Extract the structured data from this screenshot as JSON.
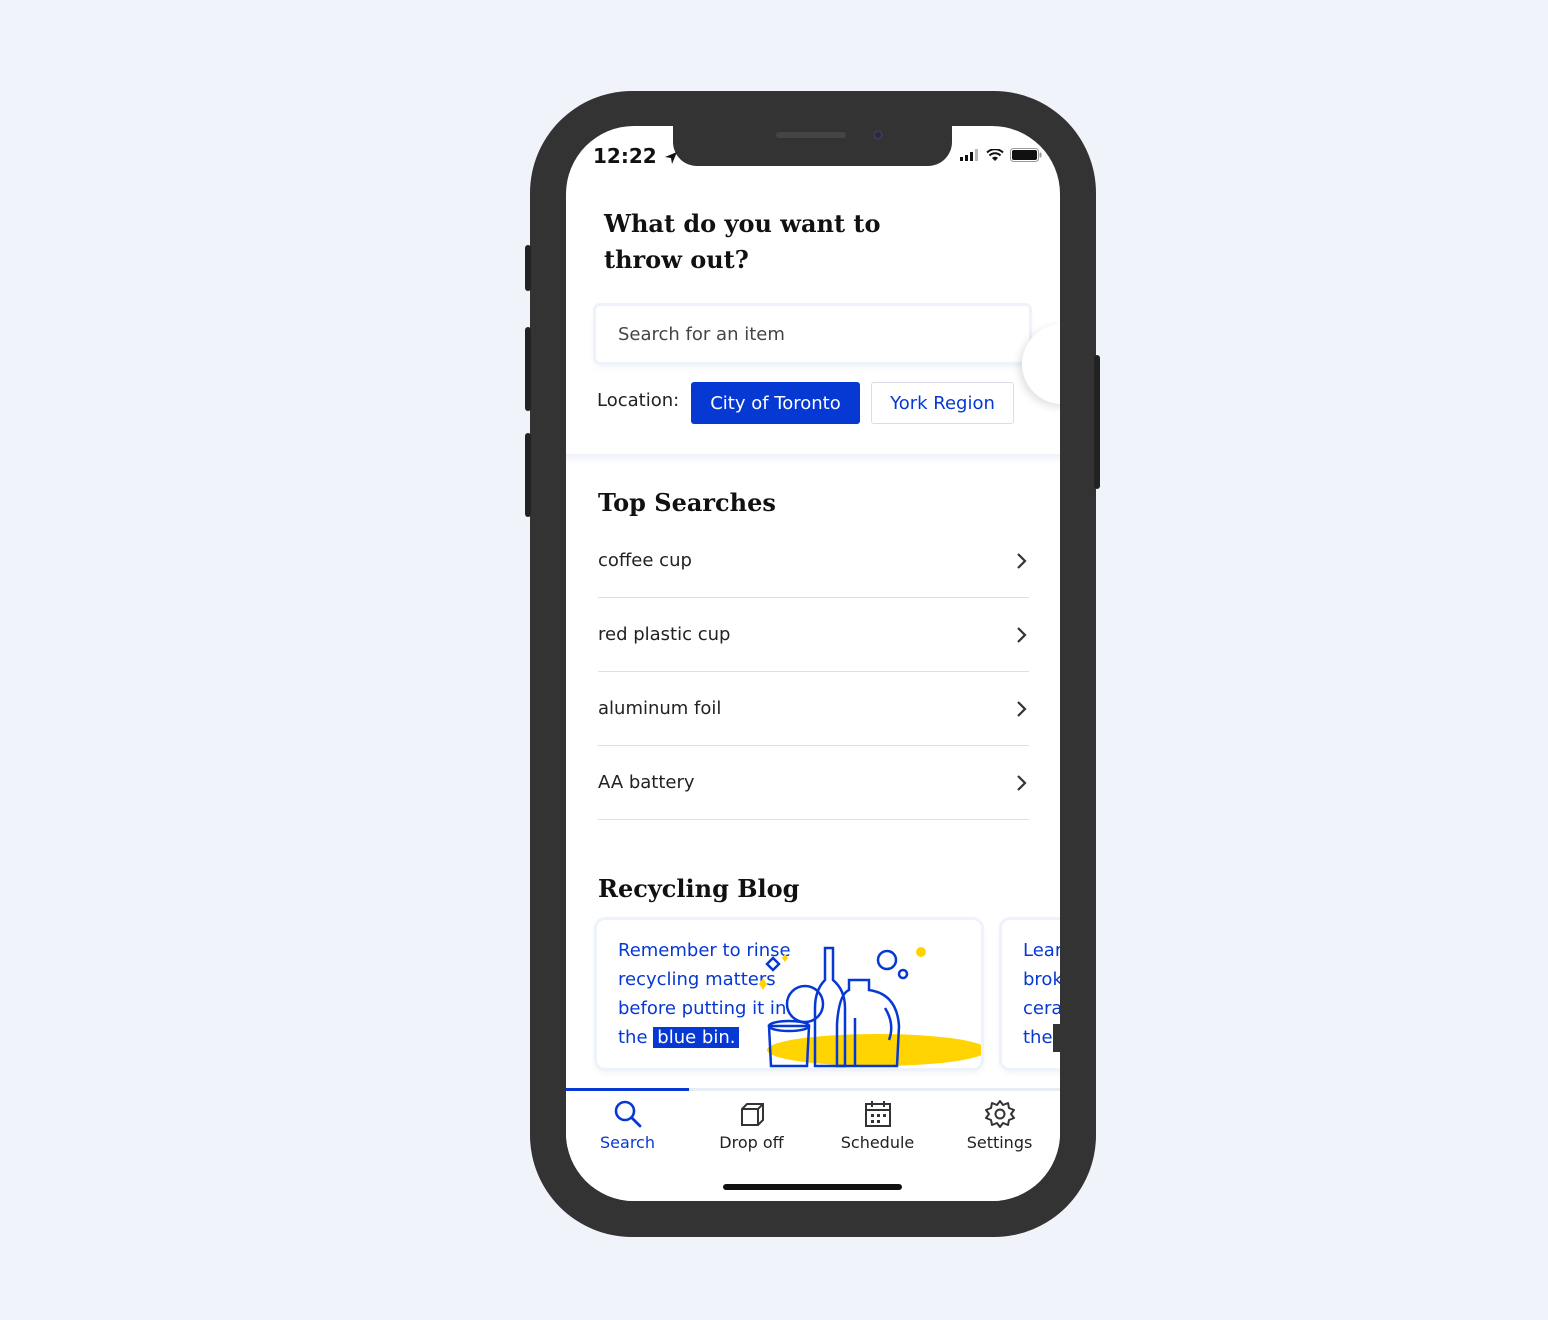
{
  "status": {
    "time": "12:22"
  },
  "header": {
    "title": "What do you want to throw out?",
    "search_placeholder": "Search for an item"
  },
  "location": {
    "label": "Location:",
    "options": [
      "City of Toronto",
      "York Region"
    ],
    "selected": "City of Toronto"
  },
  "top_searches": {
    "title": "Top Searches",
    "items": [
      "coffee cup",
      "red plastic cup",
      "aluminum foil",
      "AA battery"
    ]
  },
  "blog": {
    "title": "Recycling Blog",
    "cards": [
      {
        "text_before": "Remember to rinse recycling matters before putting it in the",
        "highlight": "blue bin."
      },
      {
        "text_lines": [
          "Lear",
          "brok",
          "cera",
          "the"
        ]
      }
    ]
  },
  "tabs": [
    {
      "label": "Search",
      "icon": "search-icon",
      "active": true
    },
    {
      "label": "Drop off",
      "icon": "box-icon",
      "active": false
    },
    {
      "label": "Schedule",
      "icon": "calendar-icon",
      "active": false
    },
    {
      "label": "Settings",
      "icon": "gear-icon",
      "active": false
    }
  ],
  "colors": {
    "accent": "#0638d4",
    "highlight_yellow": "#ffd400",
    "background": "#f0f3fa"
  }
}
